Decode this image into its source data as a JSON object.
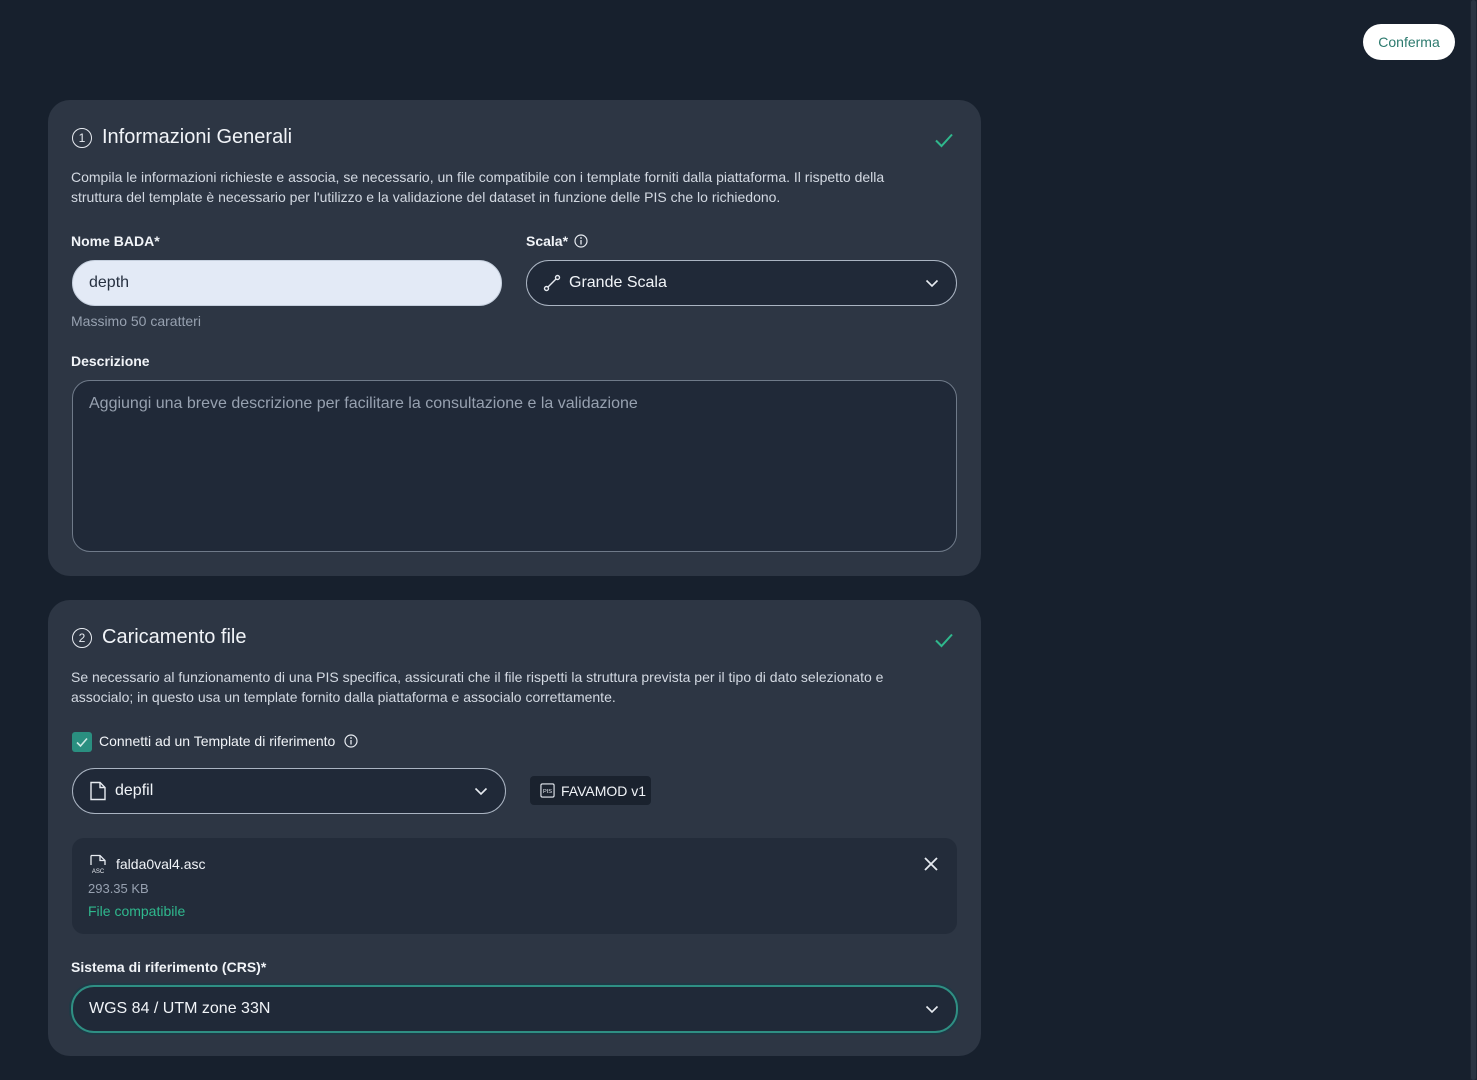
{
  "header": {
    "confirm_label": "Conferma"
  },
  "general": {
    "step": "1",
    "title": "Informazioni Generali",
    "description": "Compila le informazioni richieste e associa, se necessario, un file compatibile con i template forniti dalla piattaforma. Il rispetto della struttura del template è necessario per l'utilizzo e la validazione del dataset in funzione delle PIS che lo richiedono.",
    "name_label": "Nome BADA*",
    "name_value": "depth",
    "name_hint": "Massimo 50 caratteri",
    "scale_label": "Scala*",
    "scale_value": "Grande Scala",
    "description_label": "Descrizione",
    "description_placeholder": "Aggiungi una breve descrizione per facilitare la consultazione e la validazione"
  },
  "upload": {
    "step": "2",
    "title": "Caricamento file",
    "description": "Se necessario al funzionamento di una PIS specifica, assicurati che il file rispetti la struttura prevista per il tipo di dato selezionato e associalo; in questo usa un template fornito dalla piattaforma e associalo correttamente.",
    "connect_label": "Connetti ad un Template di riferimento",
    "connect_checked": true,
    "template_value": "depfil",
    "pis_tag": "FAVAMOD v1",
    "file": {
      "name": "falda0val4.asc",
      "size": "293.35 KB",
      "status": "File compatibile"
    },
    "crs_label": "Sistema di riferimento (CRS)*",
    "crs_value": "WGS 84 / UTM zone 33N"
  },
  "colors": {
    "background": "#17202d",
    "card": "#2d3644",
    "accent": "#2a8f80",
    "success": "#2fb88d"
  }
}
